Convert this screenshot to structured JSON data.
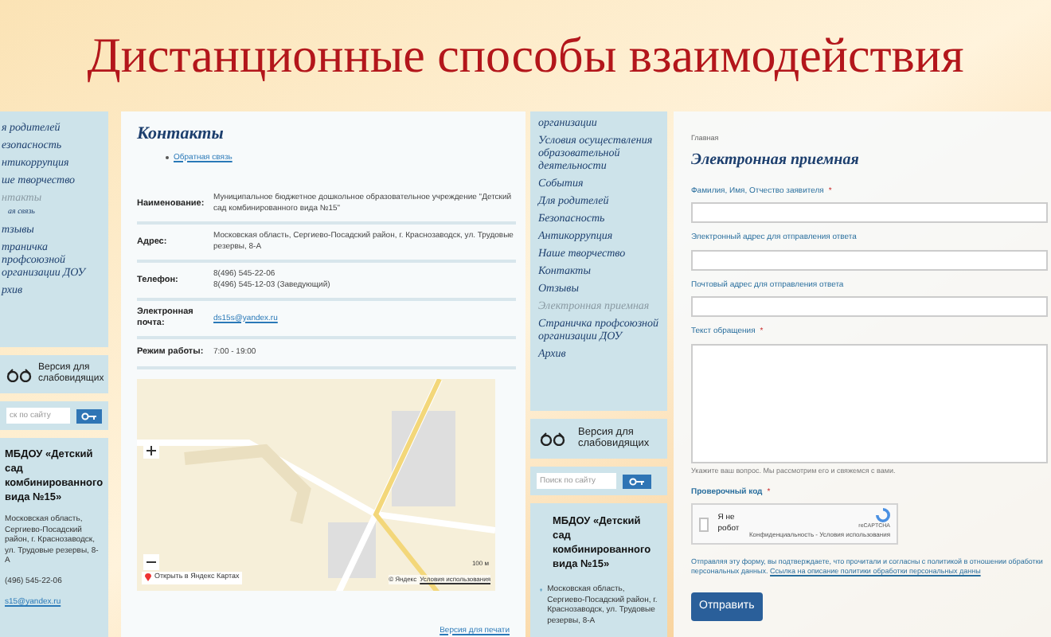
{
  "title": "Дистанционные способы взаимодействия",
  "left_screen": {
    "sidebar": {
      "items": [
        {
          "label": "я родителей",
          "selected": false
        },
        {
          "label": "езопасность",
          "selected": false
        },
        {
          "label": "нтикоррупция",
          "selected": false
        },
        {
          "label": "ше творчество",
          "selected": false
        },
        {
          "label": "нтакты",
          "selected": true,
          "children": [
            {
              "label": "ая связь",
              "selected": false
            }
          ]
        },
        {
          "label": "тзывы",
          "selected": false
        },
        {
          "label": "траничка профсоюзной организации ДОУ",
          "selected": false
        },
        {
          "label": "рхив",
          "selected": false
        }
      ]
    },
    "low_vision": "Версия для слабовидящих",
    "search": {
      "placeholder": "ск по сайту"
    },
    "info": {
      "name": "МБДОУ «Детский сад комбинированного вида №15»",
      "address": "Московская область, Сергиево-Посадский район, г. Краснозаводск, ул. Трудовые резервы, 8-А",
      "phone": "(496) 545-22-06",
      "email": "s15@yandex.ru"
    },
    "page": {
      "heading": "Контакты",
      "links": [
        "Обратная связь"
      ],
      "table": [
        {
          "label": "Наименование:",
          "lines": [
            "Муниципальное бюджетное дошкольное образовательное учреждение \"Детский сад комбинированного вида №15\""
          ],
          "kind": "text"
        },
        {
          "label": "Адрес:",
          "lines": [
            "Московская область, Сергиево-Посадский район, г. Краснозаводск, ул. Трудовые резервы, 8-А"
          ],
          "kind": "text"
        },
        {
          "label": "Телефон:",
          "lines": [
            "8(496) 545-22-06",
            "8(496) 545-12-03 (Заведующий)"
          ],
          "kind": "text"
        },
        {
          "label": "Электронная почта:",
          "lines": [
            "ds15s@yandex.ru"
          ],
          "kind": "link"
        },
        {
          "label": "Режим работы:",
          "lines": [
            "7:00 - 19:00"
          ],
          "kind": "text"
        }
      ],
      "map": {
        "open_button": "Открыть в Яндекс Картах",
        "scale": "100 м",
        "copyright": "© Яндекс",
        "terms": "Условия использования"
      },
      "print_link": "Версия для печати"
    }
  },
  "right_screen": {
    "sidebar": {
      "items": [
        {
          "label": "организации",
          "selected": false
        },
        {
          "label": "Условия осуществления образовательной деятельности",
          "selected": false
        },
        {
          "label": "События",
          "selected": false
        },
        {
          "label": "Для родителей",
          "selected": false
        },
        {
          "label": "Безопасность",
          "selected": false
        },
        {
          "label": "Антикоррупция",
          "selected": false
        },
        {
          "label": "Наше творчество",
          "selected": false
        },
        {
          "label": "Контакты",
          "selected": false
        },
        {
          "label": "Отзывы",
          "selected": false
        },
        {
          "label": "Электронная приемная",
          "selected": true
        },
        {
          "label": "Страничка профсоюзной организации ДОУ",
          "selected": false
        },
        {
          "label": "Архив",
          "selected": false
        }
      ]
    },
    "low_vision": "Версия для слабовидящих",
    "search": {
      "placeholder": "Поиск по сайту"
    },
    "info": {
      "name": "МБДОУ «Детский сад комбинированного вида №15»",
      "address": "Московская область, Сергиево-Посадский район, г. Краснозаводск, ул. Трудовые резервы, 8-А"
    },
    "page": {
      "breadcrumb": "Главная",
      "heading": "Электронная приемная",
      "fields": [
        {
          "label": "Фамилия, Имя, Отчество заявителя",
          "marker": "*",
          "kind": "input"
        },
        {
          "label": "Электронный адрес для отправления ответа",
          "kind": "input"
        },
        {
          "label": "Почтовый адрес для отправления ответа",
          "kind": "input"
        },
        {
          "label": "Текст обращения",
          "marker": "*",
          "kind": "textarea"
        }
      ],
      "hint": "Укажите ваш вопрос. Мы рассмотрим его и свяжемся с вами.",
      "captcha": {
        "label": "Проверочный код",
        "marker": "*",
        "checkbox_label": "Я не робот",
        "checked": false,
        "brand": "reCAPTCHA",
        "links": "Конфиденциальность - Условия использования"
      },
      "consent": "Отправляя эту форму, вы подтверждаете, что прочитали и согласны с политикой в отношении обработки персональных данных.",
      "consent_link": "Ссылка на описание политики обработки персональных данны",
      "submit": "Отправить"
    }
  }
}
